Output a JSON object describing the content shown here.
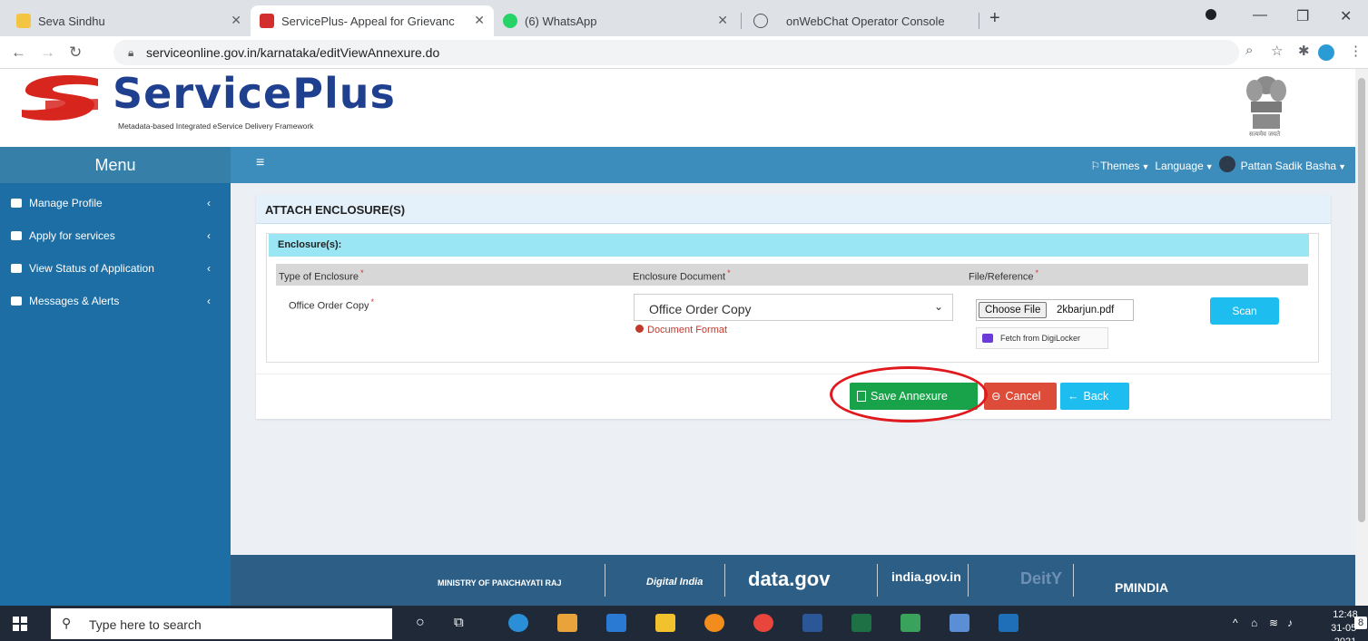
{
  "browser": {
    "tabs": [
      {
        "title": "Seva Sindhu"
      },
      {
        "title": "ServicePlus- Appeal for Grievanc"
      },
      {
        "title": "(6) WhatsApp"
      },
      {
        "title": "onWebChat Operator Console"
      }
    ],
    "url": "serviceonline.gov.in/karnataka/editViewAnnexure.do"
  },
  "site": {
    "brand": "ServicePlus",
    "tagline": "Metadata-based Integrated eService Delivery Framework",
    "emblem_caption": "सत्यमेव जयते"
  },
  "menubar": {
    "menu_label": "Menu",
    "themes": "Themes",
    "language": "Language",
    "user": "Pattan Sadik Basha"
  },
  "sidebar": {
    "items": [
      {
        "label": "Manage Profile"
      },
      {
        "label": "Apply for services"
      },
      {
        "label": "View Status of Application"
      },
      {
        "label": "Messages & Alerts"
      }
    ]
  },
  "panel": {
    "title": "ATTACH ENCLOSURE(S)",
    "section": "Enclosure(s):",
    "columns": [
      "Type of Enclosure",
      "Enclosure Document",
      "File/Reference"
    ],
    "row": {
      "type": "Office Order Copy",
      "document": "Office Order Copy",
      "format_note": "Document Format",
      "choose_file": "Choose File",
      "file_name": "2kbarjun.pdf",
      "digilocker": "Fetch from DigiLocker",
      "scan": "Scan"
    },
    "buttons": {
      "save": "Save Annexure",
      "cancel": "Cancel",
      "back": "Back"
    }
  },
  "footer": {
    "logos": [
      "MINISTRY OF PANCHAYATI RAJ",
      "Digital India",
      "data.gov",
      "india.gov.in",
      "DeitY",
      "PMINDIA"
    ]
  },
  "taskbar": {
    "search_placeholder": "Type here to search",
    "time": "12:48",
    "date": "31-05-2021",
    "notifications": "8"
  },
  "colors": {
    "sidebar": "#1c6ea4",
    "topbar": "#3c8dbc",
    "save": "#18a24a",
    "cancel": "#dd4b39",
    "back": "#1ebdf0",
    "highlight": "#e0191e"
  }
}
